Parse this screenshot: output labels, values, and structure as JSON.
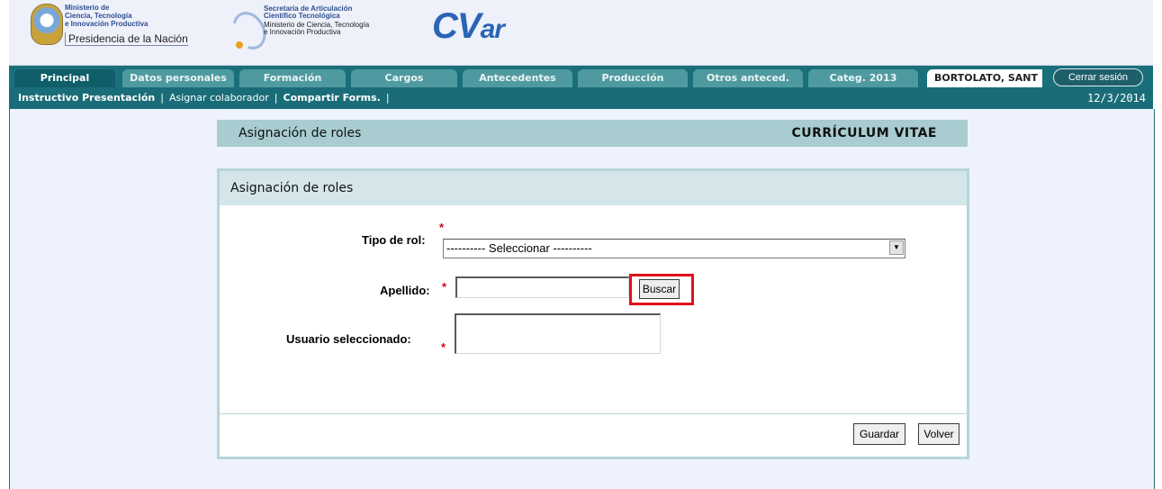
{
  "header": {
    "ministerio_lines": [
      "Ministerio de",
      "Ciencia, Tecnología",
      "e Innovación Productiva"
    ],
    "presidencia": "Presidencia de la Nación",
    "secretaria_lines": [
      "Secretaría de Articulación",
      "Científico Tecnológica",
      "Ministerio de Ciencia, Tecnología",
      "e Innovación Productiva"
    ],
    "app_logo_main": "CV",
    "app_logo_small": "ar",
    "seal_icon": "coat-of-arms-icon",
    "swirl_icon": "secretaria-logo-icon"
  },
  "nav": {
    "tabs": [
      {
        "label": "Principal",
        "active": true
      },
      {
        "label": "Datos personales"
      },
      {
        "label": "Formación"
      },
      {
        "label": "Cargos"
      },
      {
        "label": "Antecedentes"
      },
      {
        "label": "Producción"
      },
      {
        "label": "Otros anteced."
      },
      {
        "label": "Categ. 2013"
      }
    ],
    "user": "BORTOLATO, SANT",
    "logout": "Cerrar sesión"
  },
  "subnav": {
    "links": [
      "Instructivo Presentación",
      "Asignar colaborador",
      "Compartir Forms."
    ],
    "separator": "|",
    "date": "12/3/2014"
  },
  "page": {
    "title_left": "Asignación de roles",
    "title_right": "CURRÍCULUM VITAE"
  },
  "form": {
    "panel_title": "Asignación de roles",
    "required_mark": "*",
    "tipo_rol_label": "Tipo de rol:",
    "tipo_rol_value": "---------- Seleccionar ----------",
    "select_arrow_icon": "chevron-down-icon",
    "apellido_label": "Apellido:",
    "apellido_value": "",
    "buscar": "Buscar",
    "usuario_label": "Usuario seleccionado:",
    "usuario_value": "",
    "guardar": "Guardar",
    "volver": "Volver"
  },
  "colors": {
    "tab_bar": "#19707a",
    "tab": "#4f9aa0",
    "title_bar": "#a8ccd0",
    "panel_header": "#d4e6ea",
    "highlight": "#e0111d",
    "required": "#d0021b"
  }
}
